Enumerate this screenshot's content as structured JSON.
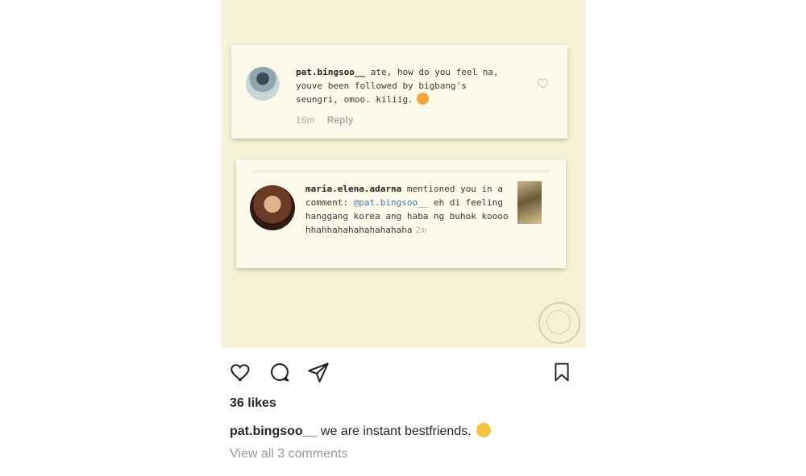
{
  "post_image": {
    "comment_card": {
      "username": "pat.bingsoo__",
      "text": " ate, how do you feel na, youve been followed by bigbang's seungri, omoo. kiliig.",
      "time": "16m",
      "reply_label": "Reply"
    },
    "mention_card": {
      "username": "maria.elena.adarna",
      "prefix": " mentioned you in a comment: ",
      "mention": "@pat.bingsoo__",
      "text": " eh di feeling hanggang korea ang haba ng buhok koooo hhahhahahahahahahaha",
      "time": "2m"
    }
  },
  "actions": {
    "like_icon": "heart-icon",
    "comment_icon": "comment-bubble-icon",
    "share_icon": "paper-plane-icon",
    "save_icon": "bookmark-icon"
  },
  "likes": "36 likes",
  "caption": {
    "username": "pat.bingsoo__",
    "text": " we are instant bestfriends."
  },
  "view_comments": "View all 3 comments"
}
